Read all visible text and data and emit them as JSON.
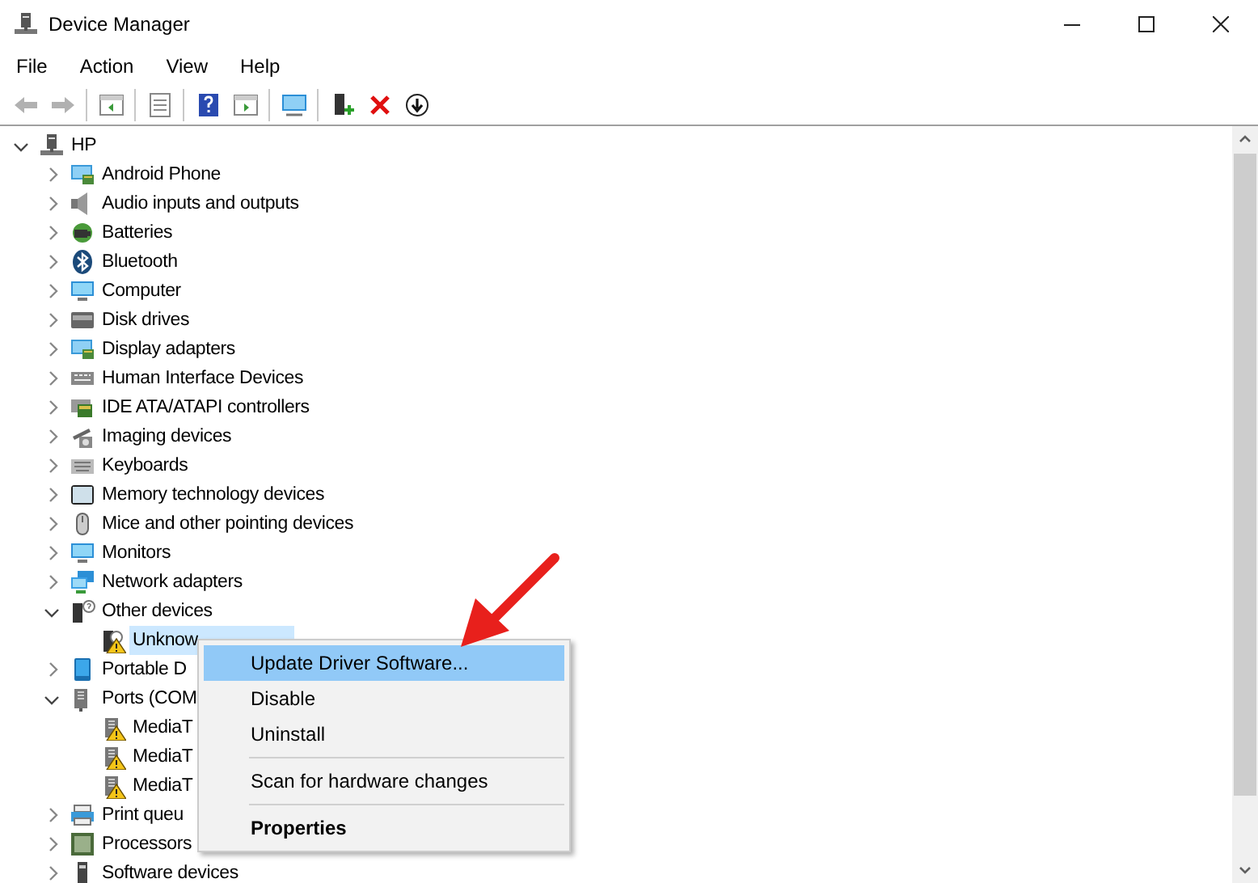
{
  "window": {
    "title": "Device Manager"
  },
  "menu_bar": [
    "File",
    "Action",
    "View",
    "Help"
  ],
  "toolbar": [
    {
      "disabled": true
    },
    {
      "disabled": true
    },
    {
      "disabled": false
    },
    {
      "disabled": false
    },
    {
      "disabled": false
    },
    {
      "disabled": false
    },
    {
      "disabled": false
    },
    {
      "disabled": false
    },
    {
      "disabled": false
    },
    {
      "disabled": false
    }
  ],
  "tree": [
    {
      "label": "HP",
      "expanded": true,
      "selected": false,
      "children": [
        {
          "label": "Android Phone",
          "expanded": false,
          "selected": false
        },
        {
          "label": "Audio inputs and outputs",
          "expanded": false,
          "selected": false
        },
        {
          "label": "Batteries",
          "expanded": false,
          "selected": false
        },
        {
          "label": "Bluetooth",
          "expanded": false,
          "selected": false
        },
        {
          "label": "Computer",
          "expanded": false,
          "selected": false
        },
        {
          "label": "Disk drives",
          "expanded": false,
          "selected": false
        },
        {
          "label": "Display adapters",
          "expanded": false,
          "selected": false
        },
        {
          "label": "Human Interface Devices",
          "expanded": false,
          "selected": false
        },
        {
          "label": "IDE ATA/ATAPI controllers",
          "expanded": false,
          "selected": false
        },
        {
          "label": "Imaging devices",
          "expanded": false,
          "selected": false
        },
        {
          "label": "Keyboards",
          "expanded": false,
          "selected": false
        },
        {
          "label": "Memory technology devices",
          "expanded": false,
          "selected": false
        },
        {
          "label": "Mice and other pointing devices",
          "expanded": false,
          "selected": false
        },
        {
          "label": "Monitors",
          "expanded": false,
          "selected": false
        },
        {
          "label": "Network adapters",
          "expanded": false,
          "selected": false
        },
        {
          "label": "Other devices",
          "expanded": true,
          "selected": false,
          "children": [
            {
              "label": "Unknow",
              "selected": true,
              "warning": true
            }
          ]
        },
        {
          "label": "Portable D",
          "expanded": false,
          "selected": false
        },
        {
          "label": "Ports (COM",
          "expanded": true,
          "selected": false,
          "children": [
            {
              "label": "MediaT",
              "selected": false,
              "warning": true
            },
            {
              "label": "MediaT",
              "selected": false,
              "warning": true
            },
            {
              "label": "MediaT",
              "selected": false,
              "warning": true
            }
          ]
        },
        {
          "label": "Print queu",
          "expanded": false,
          "selected": false
        },
        {
          "label": "Processors",
          "expanded": false,
          "selected": false
        },
        {
          "label": "Software devices",
          "expanded": false,
          "selected": false
        }
      ]
    }
  ],
  "context_menu": [
    {
      "kind": "item",
      "label": "Update Driver Software...",
      "selected": true,
      "default": false
    },
    {
      "kind": "item",
      "label": "Disable",
      "selected": false,
      "default": false
    },
    {
      "kind": "item",
      "label": "Uninstall",
      "selected": false,
      "default": false
    },
    {
      "kind": "separator"
    },
    {
      "kind": "item",
      "label": "Scan for hardware changes",
      "selected": false,
      "default": false
    },
    {
      "kind": "separator"
    },
    {
      "kind": "item",
      "label": "Properties",
      "selected": false,
      "default": true
    }
  ]
}
